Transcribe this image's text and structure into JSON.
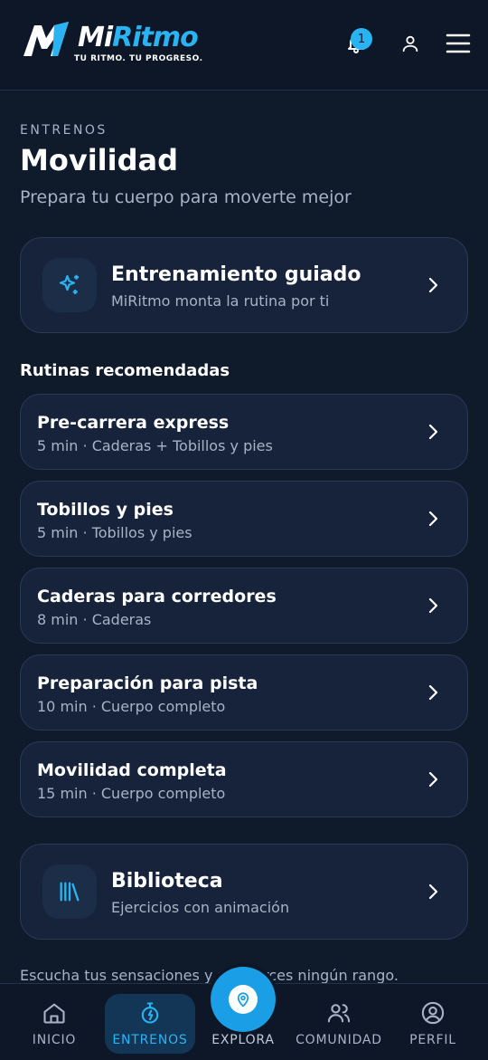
{
  "brand": {
    "name_part1": "Mi",
    "name_part2": "Ritmo",
    "tagline": "TU RITMO. TU PROGRESO.",
    "accent_color": "#2ab3f2"
  },
  "header": {
    "notification_count": "1",
    "icons": [
      "bell-icon",
      "user-icon",
      "hamburger-menu-icon"
    ]
  },
  "page": {
    "eyebrow": "ENTRENOS",
    "title": "Movilidad",
    "subtitle": "Prepara tu cuerpo para moverte mejor"
  },
  "guided": {
    "title": "Entrenamiento guiado",
    "subtitle": "MiRitmo monta la rutina por ti",
    "icon": "sparkles-icon"
  },
  "recommended": {
    "heading": "Rutinas recomendadas",
    "routines": [
      {
        "title": "Pre-carrera express",
        "meta": "5 min · Caderas + Tobillos y pies"
      },
      {
        "title": "Tobillos y pies",
        "meta": "5 min · Tobillos y pies"
      },
      {
        "title": "Caderas para corredores",
        "meta": "8 min · Caderas"
      },
      {
        "title": "Preparación para pista",
        "meta": "10 min · Cuerpo completo"
      },
      {
        "title": "Movilidad completa",
        "meta": "15 min · Cuerpo completo"
      }
    ]
  },
  "library": {
    "title": "Biblioteca",
    "subtitle": "Ejercicios con animación",
    "icon": "library-books-icon"
  },
  "footnote": "Escucha tus sensaciones y no fuerces ningún rango.",
  "tabbar": {
    "items": [
      {
        "label": "INICIO",
        "icon": "home-icon"
      },
      {
        "label": "ENTRENOS",
        "icon": "stopwatch-icon",
        "active": true
      },
      {
        "label": "EXPLORA",
        "icon": "map-pin-icon"
      },
      {
        "label": "COMUNIDAD",
        "icon": "people-icon"
      },
      {
        "label": "PERFIL",
        "icon": "profile-icon"
      }
    ]
  }
}
